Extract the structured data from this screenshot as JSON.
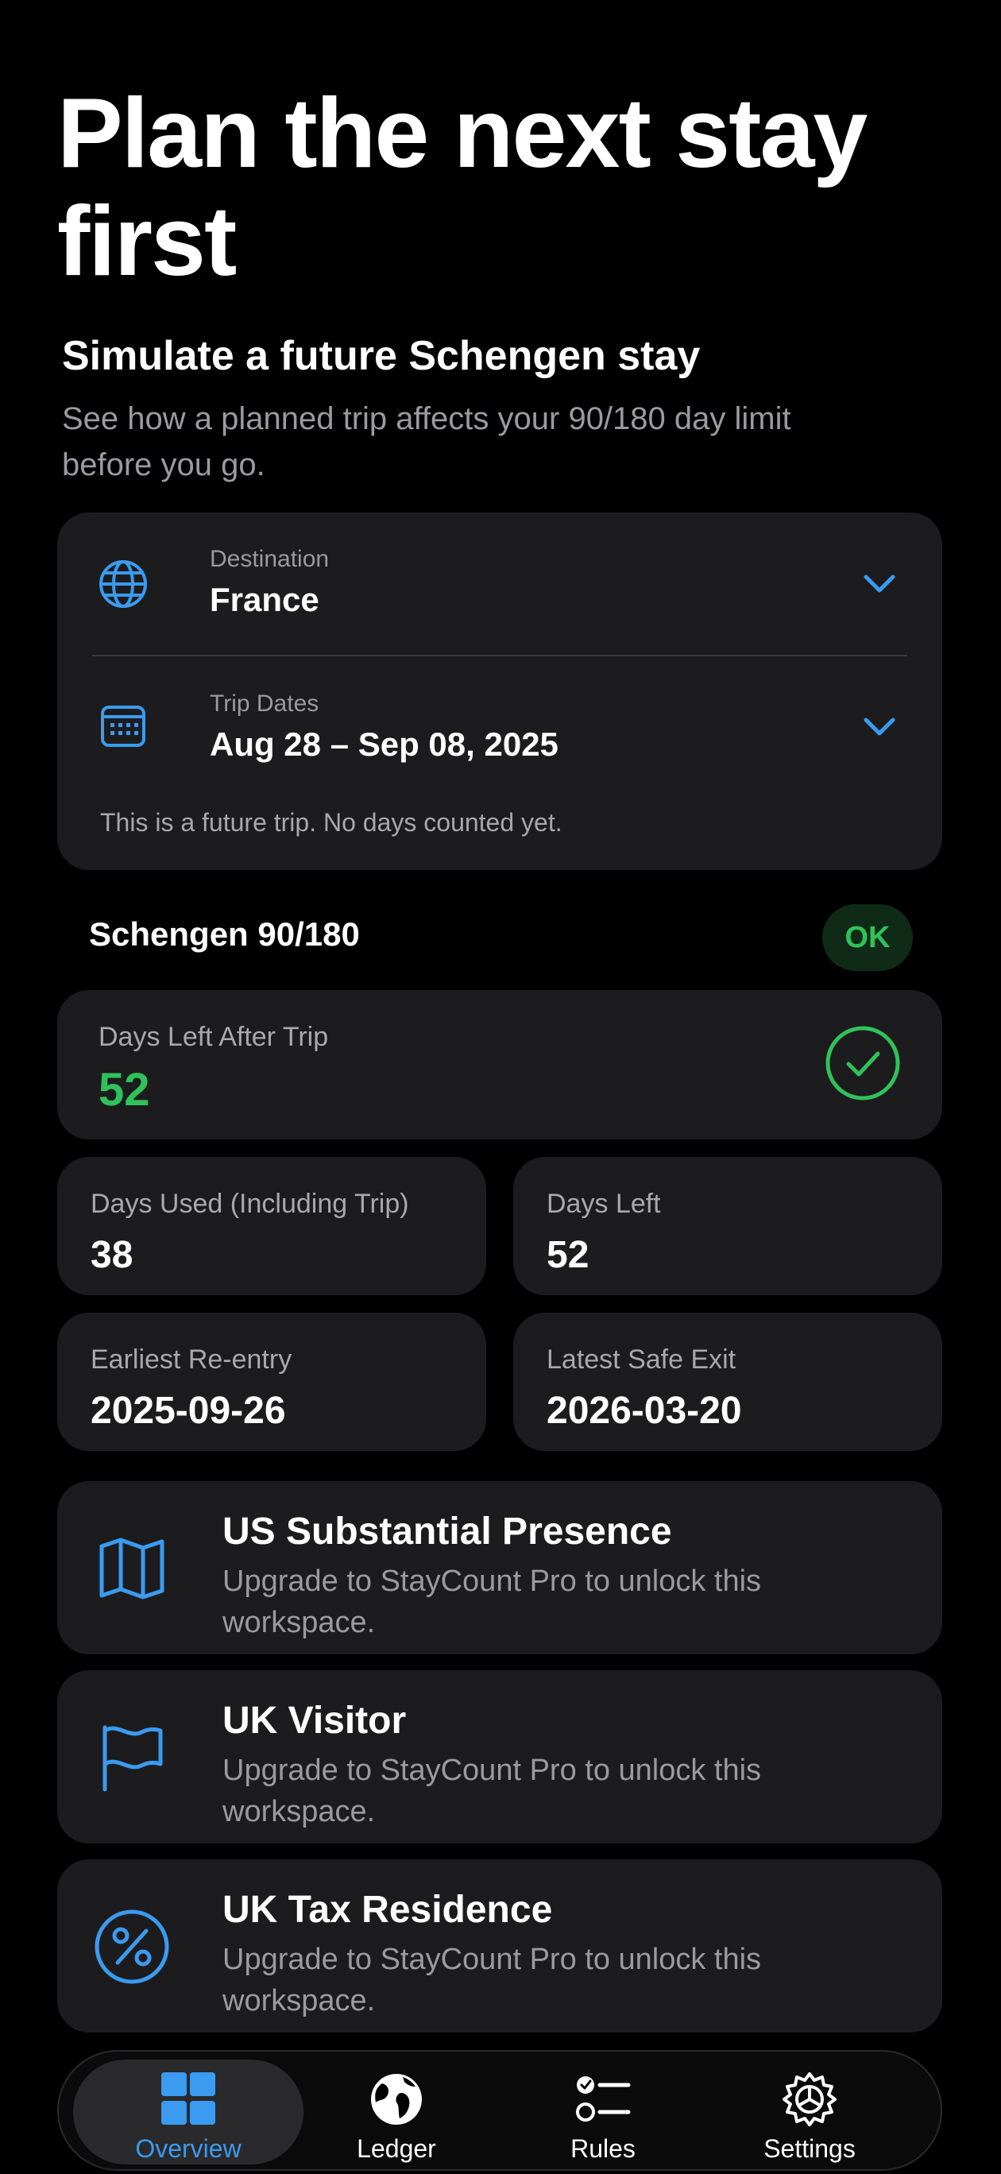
{
  "header": {
    "title": "Plan the next stay first",
    "subtitle": "Simulate a future Schengen stay",
    "description": "See how a planned trip affects your 90/180 day limit before you go."
  },
  "trip": {
    "destination_label": "Destination",
    "destination_value": "France",
    "dates_label": "Trip Dates",
    "dates_value": "Aug 28 – Sep 08, 2025",
    "note": "This is a future trip. No days counted yet."
  },
  "schengen": {
    "title": "Schengen 90/180",
    "status": "OK",
    "days_left_after_trip_label": "Days Left After Trip",
    "days_left_after_trip_value": "52",
    "stats": [
      {
        "label": "Days Used (Including Trip)",
        "value": "38"
      },
      {
        "label": "Days Left",
        "value": "52"
      },
      {
        "label": "Earliest Re-entry",
        "value": "2025-09-26"
      },
      {
        "label": "Latest Safe Exit",
        "value": "2026-03-20"
      }
    ]
  },
  "workspaces": [
    {
      "title": "US Substantial Presence",
      "body": "Upgrade to StayCount Pro to unlock this workspace.",
      "icon": "map-icon"
    },
    {
      "title": "UK Visitor",
      "body": "Upgrade to StayCount Pro to unlock this workspace.",
      "icon": "flag-icon"
    },
    {
      "title": "UK Tax Residence",
      "body": "Upgrade to StayCount Pro to unlock this workspace.",
      "icon": "percent-icon"
    }
  ],
  "tabs": [
    {
      "label": "Overview",
      "icon": "grid-icon",
      "active": true
    },
    {
      "label": "Ledger",
      "icon": "globe-icon"
    },
    {
      "label": "Rules",
      "icon": "checklist-icon"
    },
    {
      "label": "Settings",
      "icon": "gear-icon"
    }
  ],
  "colors": {
    "accent": "#3a9bf0",
    "success": "#30c25a",
    "card": "#1c1c1e",
    "background": "#000000"
  }
}
